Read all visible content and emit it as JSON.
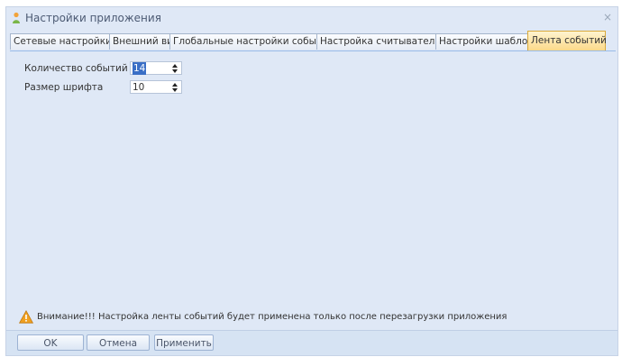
{
  "window": {
    "title": "Настройки приложения",
    "close_glyph": "×"
  },
  "tabs": [
    {
      "label": "Сетевые настройки",
      "active": false
    },
    {
      "label": "Внешний вид",
      "active": false
    },
    {
      "label": "Глобальные настройки событий",
      "active": false
    },
    {
      "label": "Настройка считывателей",
      "active": false
    },
    {
      "label": "Настройки шаблона",
      "active": false
    },
    {
      "label": "Лента событий",
      "active": true
    }
  ],
  "fields": {
    "event_count": {
      "label": "Количество событий",
      "value": "14"
    },
    "font_size": {
      "label": "Размер шрифта",
      "value": "10"
    }
  },
  "warning": {
    "text": "Внимание!!! Настройка ленты событий будет применена только после перезагрузки приложения",
    "icon": "warning-triangle-icon"
  },
  "buttons": {
    "ok": "OK",
    "cancel": "Отмена",
    "apply": "Применить"
  },
  "colors": {
    "window_bg": "#dfe8f6",
    "active_tab": "#fcd98a",
    "selection": "#3a6fc6",
    "warning": "#f0a020"
  }
}
